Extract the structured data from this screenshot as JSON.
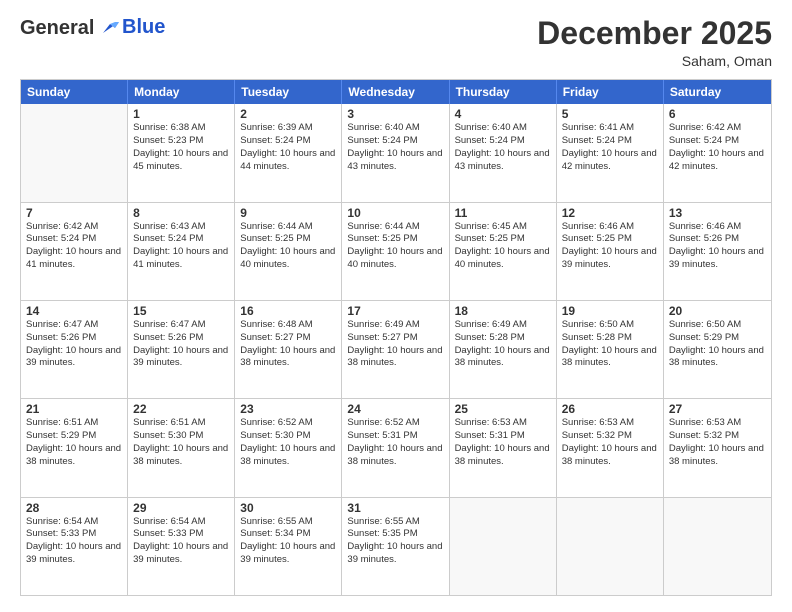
{
  "header": {
    "logo": {
      "line1": "General",
      "line2": "Blue"
    },
    "month": "December 2025",
    "location": "Saham, Oman"
  },
  "days_of_week": [
    "Sunday",
    "Monday",
    "Tuesday",
    "Wednesday",
    "Thursday",
    "Friday",
    "Saturday"
  ],
  "weeks": [
    [
      {
        "day": null,
        "sunrise": null,
        "sunset": null,
        "daylight": null
      },
      {
        "day": "1",
        "sunrise": "6:38 AM",
        "sunset": "5:23 PM",
        "daylight": "10 hours and 45 minutes."
      },
      {
        "day": "2",
        "sunrise": "6:39 AM",
        "sunset": "5:24 PM",
        "daylight": "10 hours and 44 minutes."
      },
      {
        "day": "3",
        "sunrise": "6:40 AM",
        "sunset": "5:24 PM",
        "daylight": "10 hours and 43 minutes."
      },
      {
        "day": "4",
        "sunrise": "6:40 AM",
        "sunset": "5:24 PM",
        "daylight": "10 hours and 43 minutes."
      },
      {
        "day": "5",
        "sunrise": "6:41 AM",
        "sunset": "5:24 PM",
        "daylight": "10 hours and 42 minutes."
      },
      {
        "day": "6",
        "sunrise": "6:42 AM",
        "sunset": "5:24 PM",
        "daylight": "10 hours and 42 minutes."
      }
    ],
    [
      {
        "day": "7",
        "sunrise": "6:42 AM",
        "sunset": "5:24 PM",
        "daylight": "10 hours and 41 minutes."
      },
      {
        "day": "8",
        "sunrise": "6:43 AM",
        "sunset": "5:24 PM",
        "daylight": "10 hours and 41 minutes."
      },
      {
        "day": "9",
        "sunrise": "6:44 AM",
        "sunset": "5:25 PM",
        "daylight": "10 hours and 40 minutes."
      },
      {
        "day": "10",
        "sunrise": "6:44 AM",
        "sunset": "5:25 PM",
        "daylight": "10 hours and 40 minutes."
      },
      {
        "day": "11",
        "sunrise": "6:45 AM",
        "sunset": "5:25 PM",
        "daylight": "10 hours and 40 minutes."
      },
      {
        "day": "12",
        "sunrise": "6:46 AM",
        "sunset": "5:25 PM",
        "daylight": "10 hours and 39 minutes."
      },
      {
        "day": "13",
        "sunrise": "6:46 AM",
        "sunset": "5:26 PM",
        "daylight": "10 hours and 39 minutes."
      }
    ],
    [
      {
        "day": "14",
        "sunrise": "6:47 AM",
        "sunset": "5:26 PM",
        "daylight": "10 hours and 39 minutes."
      },
      {
        "day": "15",
        "sunrise": "6:47 AM",
        "sunset": "5:26 PM",
        "daylight": "10 hours and 39 minutes."
      },
      {
        "day": "16",
        "sunrise": "6:48 AM",
        "sunset": "5:27 PM",
        "daylight": "10 hours and 38 minutes."
      },
      {
        "day": "17",
        "sunrise": "6:49 AM",
        "sunset": "5:27 PM",
        "daylight": "10 hours and 38 minutes."
      },
      {
        "day": "18",
        "sunrise": "6:49 AM",
        "sunset": "5:28 PM",
        "daylight": "10 hours and 38 minutes."
      },
      {
        "day": "19",
        "sunrise": "6:50 AM",
        "sunset": "5:28 PM",
        "daylight": "10 hours and 38 minutes."
      },
      {
        "day": "20",
        "sunrise": "6:50 AM",
        "sunset": "5:29 PM",
        "daylight": "10 hours and 38 minutes."
      }
    ],
    [
      {
        "day": "21",
        "sunrise": "6:51 AM",
        "sunset": "5:29 PM",
        "daylight": "10 hours and 38 minutes."
      },
      {
        "day": "22",
        "sunrise": "6:51 AM",
        "sunset": "5:30 PM",
        "daylight": "10 hours and 38 minutes."
      },
      {
        "day": "23",
        "sunrise": "6:52 AM",
        "sunset": "5:30 PM",
        "daylight": "10 hours and 38 minutes."
      },
      {
        "day": "24",
        "sunrise": "6:52 AM",
        "sunset": "5:31 PM",
        "daylight": "10 hours and 38 minutes."
      },
      {
        "day": "25",
        "sunrise": "6:53 AM",
        "sunset": "5:31 PM",
        "daylight": "10 hours and 38 minutes."
      },
      {
        "day": "26",
        "sunrise": "6:53 AM",
        "sunset": "5:32 PM",
        "daylight": "10 hours and 38 minutes."
      },
      {
        "day": "27",
        "sunrise": "6:53 AM",
        "sunset": "5:32 PM",
        "daylight": "10 hours and 38 minutes."
      }
    ],
    [
      {
        "day": "28",
        "sunrise": "6:54 AM",
        "sunset": "5:33 PM",
        "daylight": "10 hours and 39 minutes."
      },
      {
        "day": "29",
        "sunrise": "6:54 AM",
        "sunset": "5:33 PM",
        "daylight": "10 hours and 39 minutes."
      },
      {
        "day": "30",
        "sunrise": "6:55 AM",
        "sunset": "5:34 PM",
        "daylight": "10 hours and 39 minutes."
      },
      {
        "day": "31",
        "sunrise": "6:55 AM",
        "sunset": "5:35 PM",
        "daylight": "10 hours and 39 minutes."
      },
      {
        "day": null,
        "sunrise": null,
        "sunset": null,
        "daylight": null
      },
      {
        "day": null,
        "sunrise": null,
        "sunset": null,
        "daylight": null
      },
      {
        "day": null,
        "sunrise": null,
        "sunset": null,
        "daylight": null
      }
    ]
  ]
}
